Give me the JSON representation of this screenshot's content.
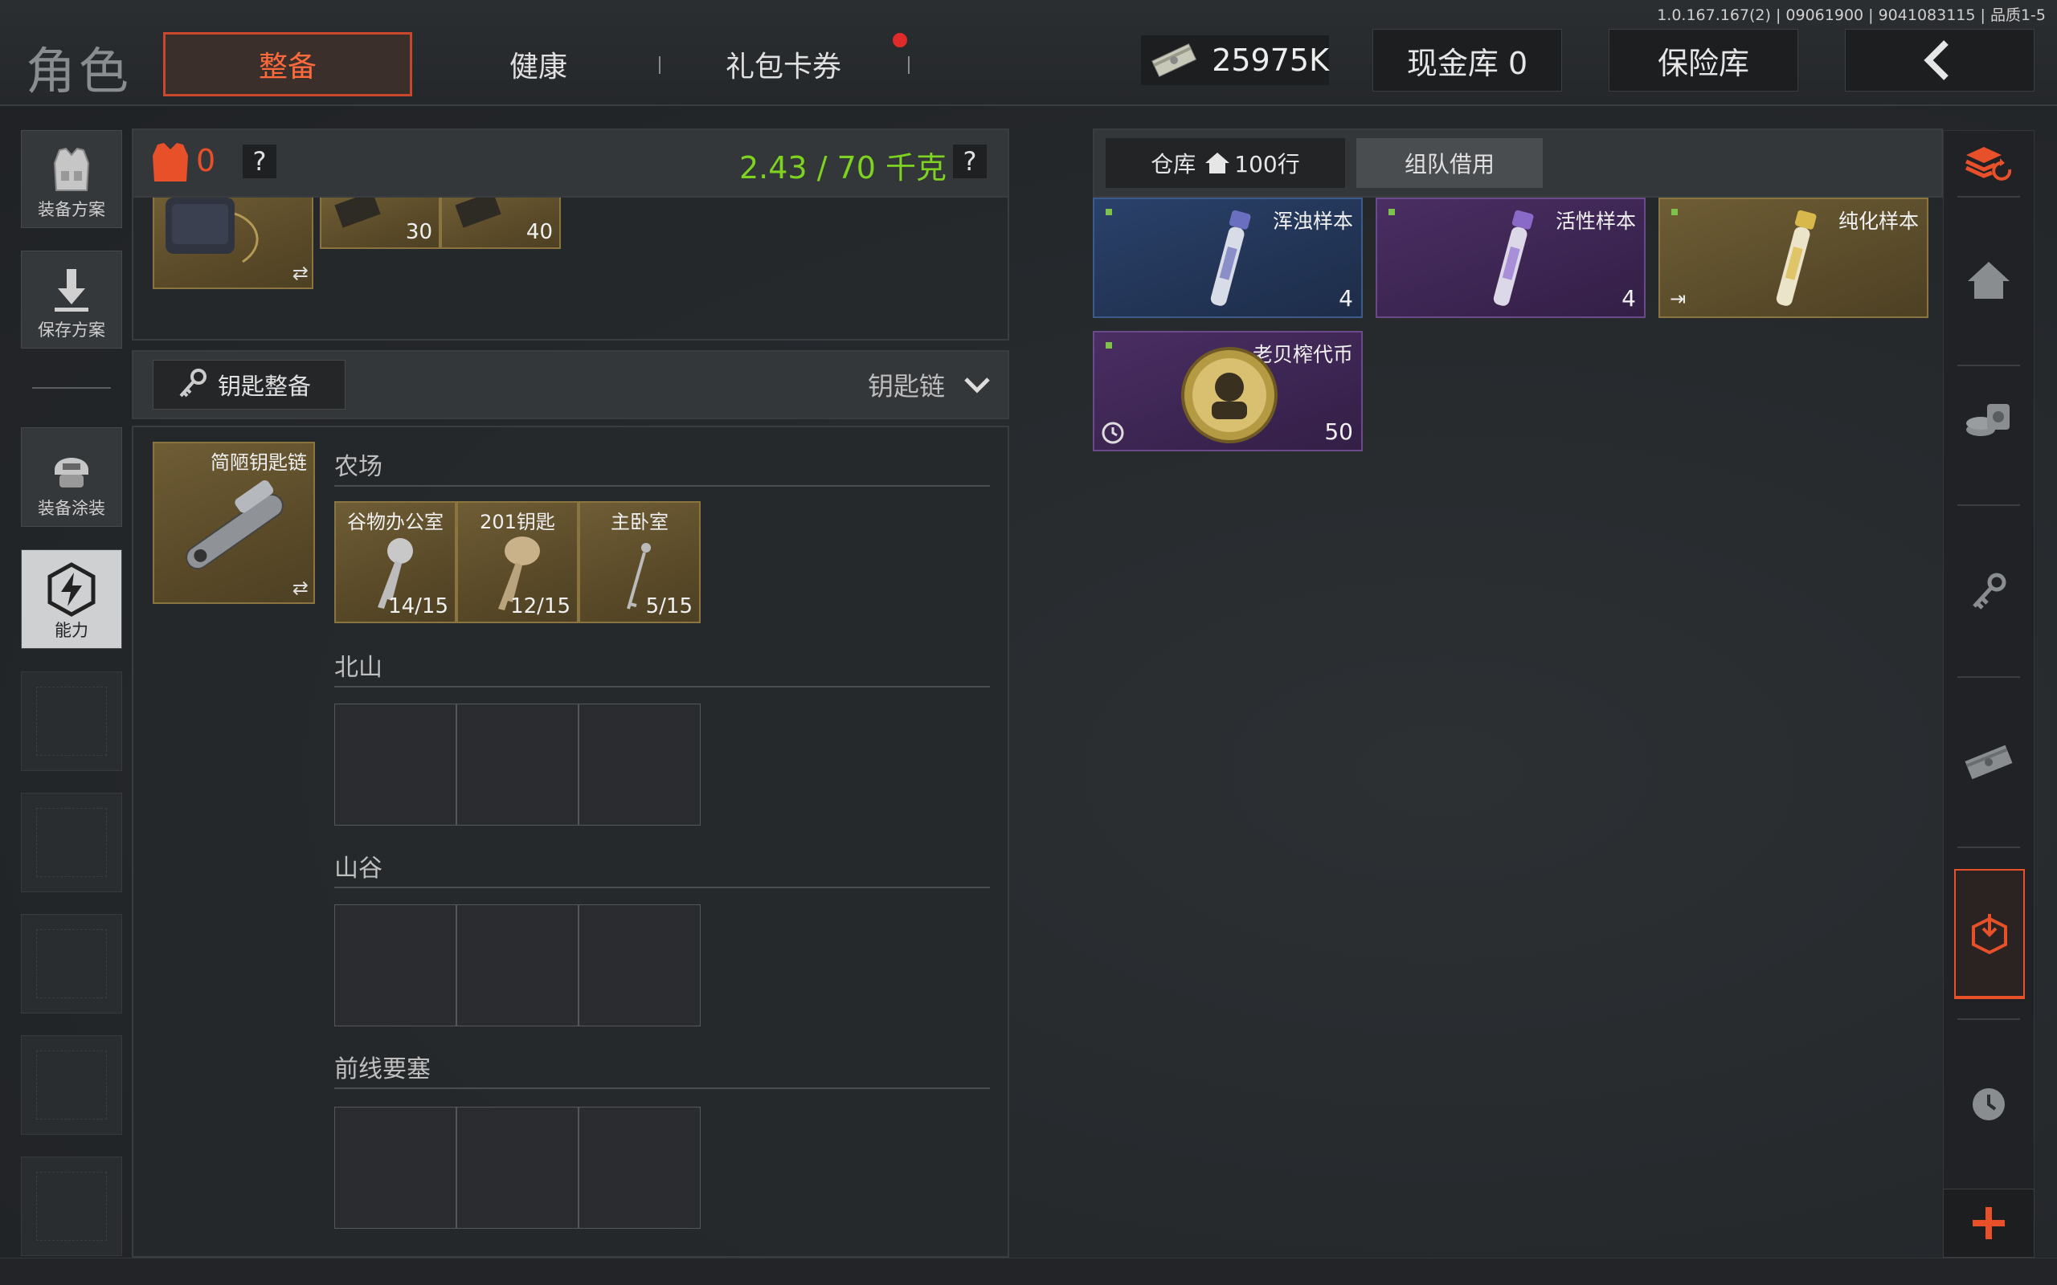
{
  "version_text": "1.0.167.167(2) | 09061900 | 9041083115 | 品质1-5",
  "page_title": "角色",
  "tabs": [
    {
      "label": "整备",
      "active": true
    },
    {
      "label": "健康",
      "active": false
    },
    {
      "label": "礼包卡券",
      "active": false,
      "has_notification": true
    }
  ],
  "currency": {
    "icon": "cash-stack-icon",
    "amount": "25975K"
  },
  "cash_vault_label": "现金库 0",
  "safe_label": "保险库",
  "back_icon": "chevron-left-icon",
  "sidebar": {
    "items": [
      {
        "label": "装备方案",
        "icon": "vest-icon"
      },
      {
        "label": "保存方案",
        "icon": "download-arrow-icon"
      },
      {
        "label": "装备涂装",
        "icon": "helmet-icon"
      },
      {
        "label": "能力",
        "icon": "lightning-badge-icon",
        "active": true
      }
    ],
    "empty_slots": 5
  },
  "inventory_header": {
    "armor_count": "0",
    "help_glyph": "?",
    "weight_text": "2.43 / 70 千克",
    "weight_color": "#7ed321"
  },
  "top_items": [
    {
      "count": "30"
    },
    {
      "count": "40"
    }
  ],
  "key_section": {
    "button_label": "钥匙整备",
    "dropdown_label": "钥匙链",
    "keychain_name": "简陋钥匙链",
    "groups": [
      {
        "name": "农场",
        "keys": [
          {
            "name": "谷物办公室",
            "count": "14/15"
          },
          {
            "name": "201钥匙",
            "count": "12/15"
          },
          {
            "name": "主卧室",
            "count": "5/15"
          }
        ]
      },
      {
        "name": "北山",
        "keys": []
      },
      {
        "name": "山谷",
        "keys": []
      },
      {
        "name": "前线要塞",
        "keys": []
      }
    ]
  },
  "warehouse": {
    "tab_warehouse": "仓库",
    "tab_rows": "100行",
    "tab_team": "组队借用",
    "items": [
      {
        "name": "浑浊样本",
        "count": "4",
        "rarity_color": "#23375a"
      },
      {
        "name": "活性样本",
        "count": "4",
        "rarity_color": "#3c2550"
      },
      {
        "name": "纯化样本",
        "count": "",
        "rarity_color": "#5e4d28"
      },
      {
        "name": "老贝榨代币",
        "count": "50",
        "rarity_color": "#3c2550"
      }
    ]
  },
  "right_rail": {
    "icons": [
      "stack-refresh-icon",
      "home-icon",
      "coins-icon",
      "key-icon",
      "cash-icon",
      "box-download-icon",
      "clock-icon",
      "plus-icon"
    ],
    "accent_color": "#e8502a"
  }
}
